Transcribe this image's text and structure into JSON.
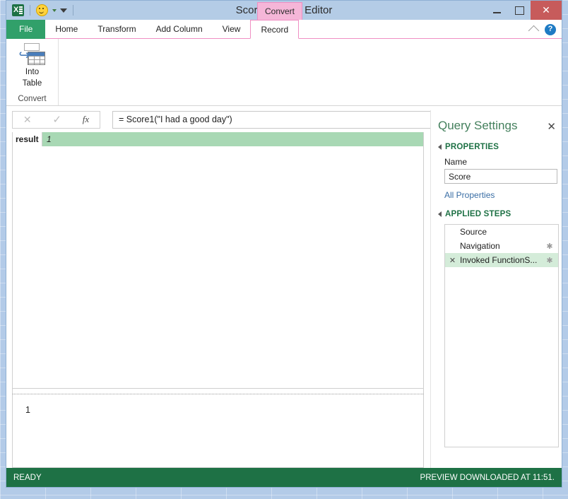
{
  "window": {
    "title": "Score - Query Editor",
    "context_tab": "Convert",
    "icons": {
      "app": "excel-icon",
      "smiley": "smiley-face-icon",
      "qat_dropdown": "chevron-down-icon",
      "minimize": "minimize-icon",
      "maximize": "maximize-icon",
      "close": "close-icon"
    },
    "controls": {
      "close_glyph": "✕"
    }
  },
  "ribbon": {
    "tabs": [
      {
        "label": "File",
        "active": false,
        "style": "file"
      },
      {
        "label": "Home",
        "active": false
      },
      {
        "label": "Transform",
        "active": false
      },
      {
        "label": "Add Column",
        "active": false
      },
      {
        "label": "View",
        "active": false
      },
      {
        "label": "Record",
        "active": true
      }
    ],
    "collapse_icon": "chevron-up-icon",
    "help_icon": "help-icon",
    "help_glyph": "?",
    "groups": [
      {
        "label": "Convert",
        "buttons": [
          {
            "label_line1": "Into",
            "label_line2": "Table",
            "icon": "into-table-icon",
            "arrow_glyph": "↪"
          }
        ]
      }
    ]
  },
  "formula_bar": {
    "cancel_glyph": "✕",
    "accept_glyph": "✓",
    "fx_label": "fx",
    "value": "= Score1(\"I had a good day\")",
    "dropdown_icon": "chevron-down-icon"
  },
  "data_pane": {
    "record": {
      "key": "result",
      "value": "1"
    }
  },
  "value_pane": {
    "value": "1"
  },
  "query_settings": {
    "title": "Query Settings",
    "close_glyph": "✕",
    "properties": {
      "section_label": "PROPERTIES",
      "name_label": "Name",
      "name_value": "Score",
      "all_properties_link": "All Properties"
    },
    "applied_steps": {
      "section_label": "APPLIED STEPS",
      "steps": [
        {
          "label": "Source",
          "selected": false,
          "has_gear": false,
          "has_delete": false
        },
        {
          "label": "Navigation",
          "selected": false,
          "has_gear": true,
          "has_delete": false
        },
        {
          "label": "Invoked FunctionS...",
          "selected": true,
          "has_gear": true,
          "has_delete": true
        }
      ],
      "delete_glyph": "✕",
      "gear_glyph": "✱"
    }
  },
  "status_bar": {
    "left": "READY",
    "right": "PREVIEW DOWNLOADED AT 11:51."
  },
  "colors": {
    "accent_green": "#1e7145",
    "context_pink": "#f5b6d8",
    "titlebar_blue": "#b4cce6",
    "record_green": "#a8d8b4",
    "selected_step": "#d4ecd9",
    "close_red": "#c75b5b"
  }
}
